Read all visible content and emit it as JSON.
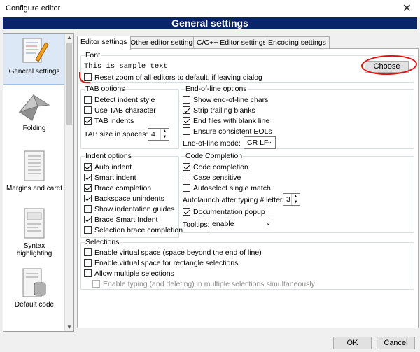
{
  "window": {
    "title": "Configure editor",
    "close_glyph": "✕"
  },
  "header": {
    "title": "General settings"
  },
  "sidebar": {
    "items": [
      {
        "label": "General settings",
        "icon": "pencil-notepad-icon"
      },
      {
        "label": "Folding",
        "icon": "origami-crane-icon"
      },
      {
        "label": "Margins and caret",
        "icon": "document-margins-icon"
      },
      {
        "label": "Syntax highlighting",
        "icon": "document-syntax-icon"
      },
      {
        "label": "Default code",
        "icon": "document-stamp-icon"
      }
    ]
  },
  "tabs": [
    {
      "label": "Editor settings"
    },
    {
      "label": "Other editor settings"
    },
    {
      "label": "C/C++ Editor settings"
    },
    {
      "label": "Encoding settings"
    }
  ],
  "font": {
    "title": "Font",
    "sample": "This is sample text",
    "choose_label": "Choose",
    "reset_zoom_label": "Reset zoom of all editors to default, if leaving dialog",
    "reset_zoom_checked": false
  },
  "tab_options": {
    "title": "TAB options",
    "items": [
      {
        "label": "Detect indent style",
        "checked": false
      },
      {
        "label": "Use TAB character",
        "checked": false
      },
      {
        "label": "TAB indents",
        "checked": true
      }
    ],
    "tab_size_label": "TAB size in spaces:",
    "tab_size_value": "4"
  },
  "eol": {
    "title": "End-of-line options",
    "items": [
      {
        "label": "Show end-of-line chars",
        "checked": false
      },
      {
        "label": "Strip trailing blanks",
        "checked": true
      },
      {
        "label": "End files with blank line",
        "checked": true
      },
      {
        "label": "Ensure consistent EOLs",
        "checked": false
      }
    ],
    "mode_label": "End-of-line mode:",
    "mode_value": "CR LF"
  },
  "indent": {
    "title": "Indent options",
    "items": [
      {
        "label": "Auto indent",
        "checked": true
      },
      {
        "label": "Smart indent",
        "checked": true
      },
      {
        "label": "Brace completion",
        "checked": true
      },
      {
        "label": "Backspace unindents",
        "checked": true
      },
      {
        "label": "Show indentation guides",
        "checked": false
      },
      {
        "label": "Brace Smart Indent",
        "checked": true
      },
      {
        "label": "Selection brace completion",
        "checked": false
      }
    ]
  },
  "completion": {
    "title": "Code Completion",
    "items": [
      {
        "label": "Code completion",
        "checked": true
      },
      {
        "label": "Case sensitive",
        "checked": false
      },
      {
        "label": "Autoselect single match",
        "checked": false
      }
    ],
    "autolaunch_label": "Autolaunch after typing # letters:",
    "autolaunch_value": "3",
    "doc_popup_label": "Documentation popup",
    "doc_popup_checked": true,
    "tooltips_label": "Tooltips:",
    "tooltips_value": "enable"
  },
  "selections": {
    "title": "Selections",
    "items": [
      {
        "label": "Enable virtual space (space beyond the end of line)",
        "checked": false
      },
      {
        "label": "Enable virtual space for rectangle selections",
        "checked": false
      },
      {
        "label": "Allow multiple selections",
        "checked": false
      }
    ],
    "typing_multi_label": "Enable typing (and deleting) in multiple selections simultaneously",
    "typing_multi_checked": false
  },
  "footer": {
    "ok_label": "OK",
    "cancel_label": "Cancel"
  },
  "colors": {
    "header_bg": "#0a246a",
    "annotation": "#e01010"
  }
}
